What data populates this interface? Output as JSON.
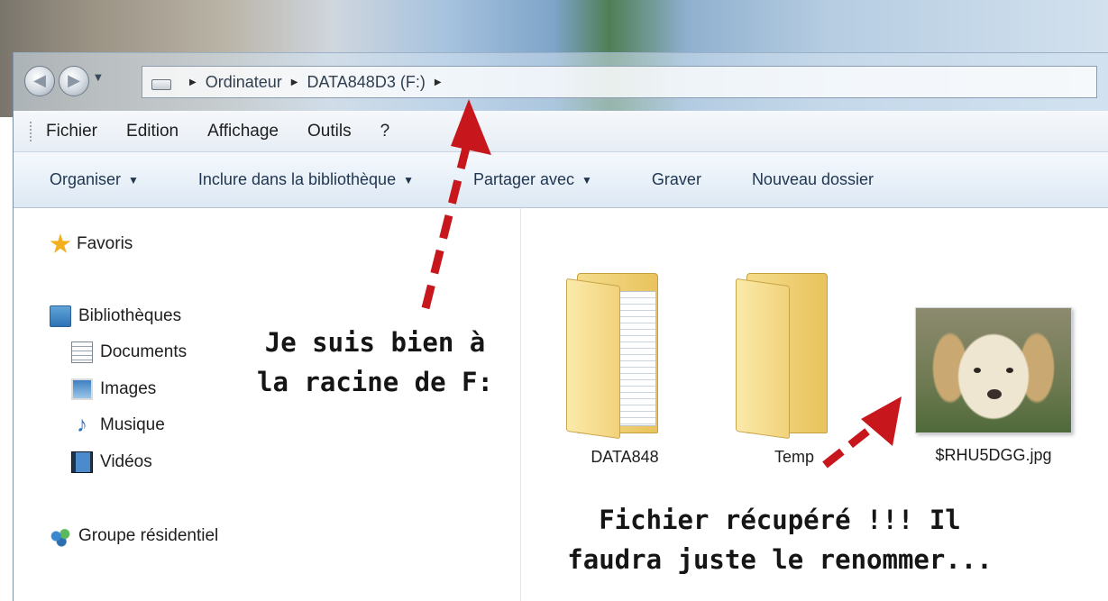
{
  "nav": {
    "back_icon": "back-arrow-icon",
    "forward_icon": "forward-arrow-icon",
    "breadcrumb": [
      "Ordinateur",
      "DATA848D3 (F:)"
    ]
  },
  "menubar": {
    "items": [
      "Fichier",
      "Edition",
      "Affichage",
      "Outils",
      "?"
    ]
  },
  "commandbar": {
    "organize": "Organiser",
    "include": "Inclure dans la bibliothèque",
    "share": "Partager avec",
    "burn": "Graver",
    "new_folder": "Nouveau dossier"
  },
  "navpane": {
    "favorites": "Favoris",
    "libraries": "Bibliothèques",
    "documents": "Documents",
    "images": "Images",
    "music": "Musique",
    "videos": "Vidéos",
    "homegroup": "Groupe résidentiel"
  },
  "files": [
    {
      "name": "DATA848",
      "type": "folder"
    },
    {
      "name": "Temp",
      "type": "folder"
    },
    {
      "name": "$RHU5DGG.jpg",
      "type": "image"
    }
  ],
  "annotations": {
    "root_line1": "Je suis bien à",
    "root_line2": "la racine de F:",
    "recovered_line1": "Fichier récupéré !!!  Il",
    "recovered_line2": "faudra juste le renommer..."
  },
  "colors": {
    "arrow": "#c8161d",
    "command_text": "#1f3550",
    "folder": "#f1d27a"
  }
}
